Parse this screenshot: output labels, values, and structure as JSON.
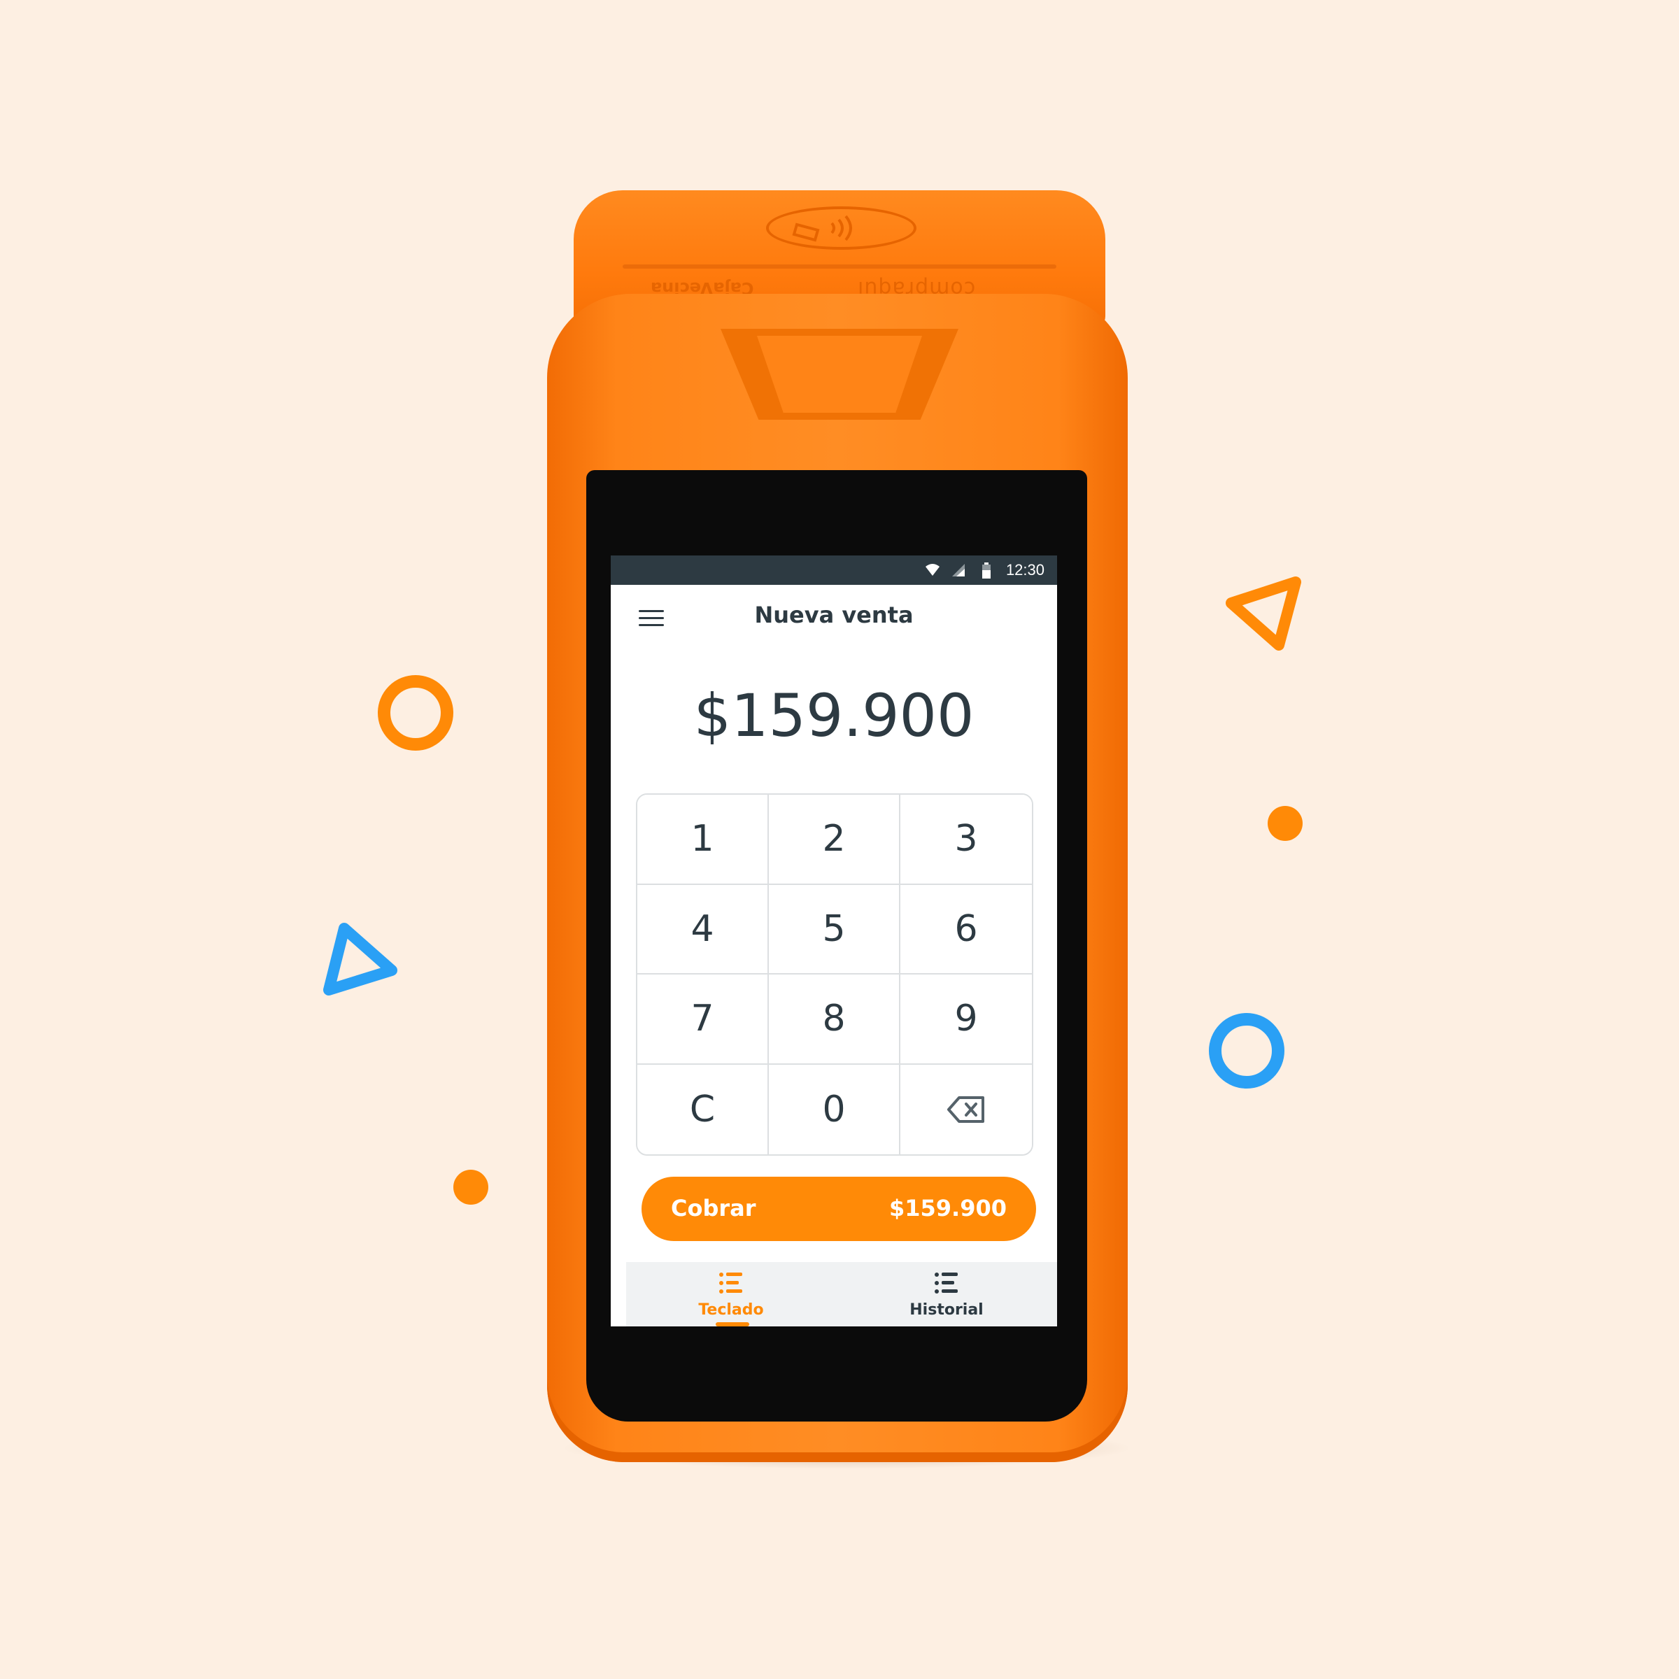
{
  "colors": {
    "background": "#fdefe2",
    "device_orange": "#ff8418",
    "accent_orange": "#ff8a07",
    "accent_blue": "#2aa0f5",
    "text_dark": "#2d3a42"
  },
  "device": {
    "brand_left": "CajaVecina",
    "brand_right": "compraquí",
    "contactless_icon": "contactless-payment-icon"
  },
  "status_bar": {
    "time": "12:30",
    "icons": [
      "wifi-icon",
      "signal-icon",
      "battery-icon"
    ]
  },
  "header": {
    "menu_icon": "menu-icon",
    "title": "Nueva venta"
  },
  "amount": "$159.900",
  "keypad": {
    "keys": [
      "1",
      "2",
      "3",
      "4",
      "5",
      "6",
      "7",
      "8",
      "9",
      "C",
      "0"
    ],
    "backspace_icon": "backspace-icon"
  },
  "charge_button": {
    "label": "Cobrar",
    "amount": "$159.900"
  },
  "bottom_nav": {
    "tabs": [
      {
        "label": "Teclado",
        "icon": "list-icon",
        "active": true
      },
      {
        "label": "Historial",
        "icon": "list-icon",
        "active": false
      }
    ]
  }
}
